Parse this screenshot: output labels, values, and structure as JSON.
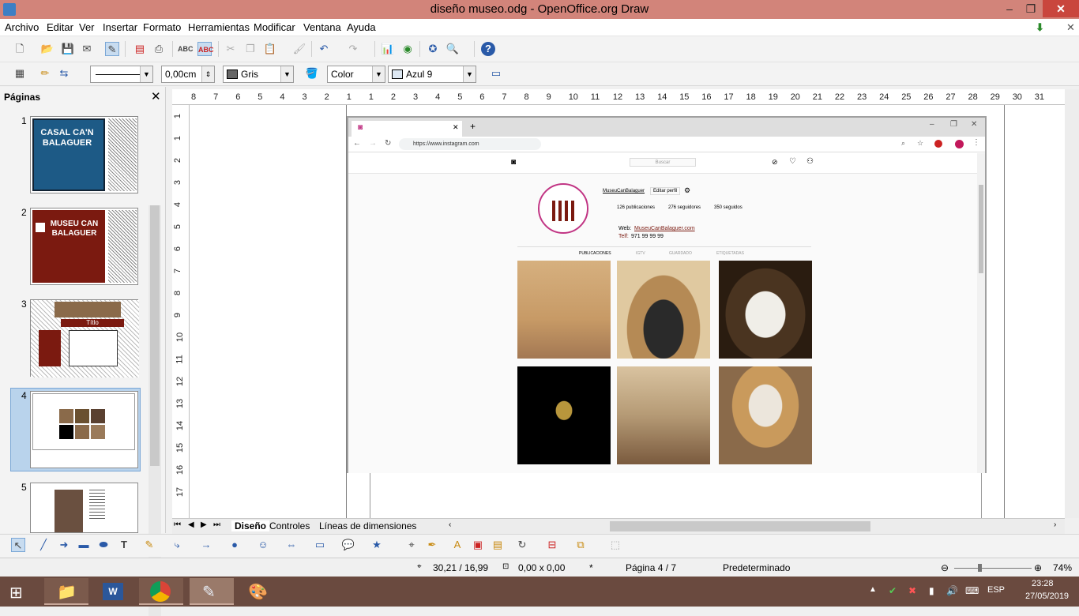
{
  "window": {
    "title": "diseño museo.odg - OpenOffice.org Draw",
    "minimize": "–",
    "maximize": "❐",
    "close": "✕"
  },
  "menu": [
    "Archivo",
    "Editar",
    "Ver",
    "Insertar",
    "Formato",
    "Herramientas",
    "Modificar",
    "Ventana",
    "Ayuda"
  ],
  "toolbar2": {
    "line_width": "0,00cm",
    "line_color": "Gris",
    "fill_mode": "Color",
    "fill_color": "Azul 9"
  },
  "pages_panel": {
    "title": "Páginas",
    "slides": [
      {
        "number": "1",
        "text": "CASAL CA'N BALAGUER"
      },
      {
        "number": "2",
        "text": "MUSEU CAN BALAGUER"
      },
      {
        "number": "3",
        "text": "Títlo"
      },
      {
        "number": "4",
        "text": ""
      },
      {
        "number": "5",
        "text": ""
      }
    ]
  },
  "ruler": {
    "h_ticks": [
      "8",
      "7",
      "6",
      "5",
      "4",
      "3",
      "2",
      "1",
      "1",
      "2",
      "3",
      "4",
      "5",
      "6",
      "7",
      "8",
      "9",
      "10",
      "11",
      "12",
      "13",
      "14",
      "15",
      "16",
      "17",
      "18",
      "19",
      "20",
      "21",
      "22",
      "23",
      "24",
      "25",
      "26",
      "27",
      "28",
      "29",
      "30",
      "31"
    ],
    "v_ticks": [
      "1",
      "1",
      "2",
      "3",
      "4",
      "5",
      "6",
      "7",
      "8",
      "9",
      "10",
      "11",
      "12",
      "13",
      "14",
      "15",
      "16",
      "17"
    ]
  },
  "browser": {
    "url": "https://www.instagram.com",
    "search_placeholder": "Buscar",
    "profile_name": "MuseuCanBalaguer",
    "edit_profile": "Editar perfil",
    "posts": "126 publicaciones",
    "followers": "276 seguidores",
    "following": "350 seguidos",
    "web_label": "Web:",
    "web_value": "MuseuCanBalaguer.com",
    "phone_label": "Telf:",
    "phone_value": "971 99 99 99",
    "tabs": [
      "PUBLICACIONES",
      "IGTV",
      "GUARDADO",
      "ETIQUETADAS"
    ]
  },
  "sheet_tabs": [
    "Diseño",
    "Controles",
    "Líneas de dimensiones"
  ],
  "status": {
    "position": "30,21 / 16,99",
    "size": "0,00 x 0,00",
    "modified": "*",
    "page": "Página 4 / 7",
    "layout": "Predeterminado",
    "zoom": "74%"
  },
  "taskbar": {
    "lang": "ESP",
    "time": "23:28",
    "date": "27/05/2019"
  },
  "colors": {
    "titlebar": "#d2847a",
    "brand_red": "#7b1a10",
    "slide_blue": "#1d5a86"
  }
}
